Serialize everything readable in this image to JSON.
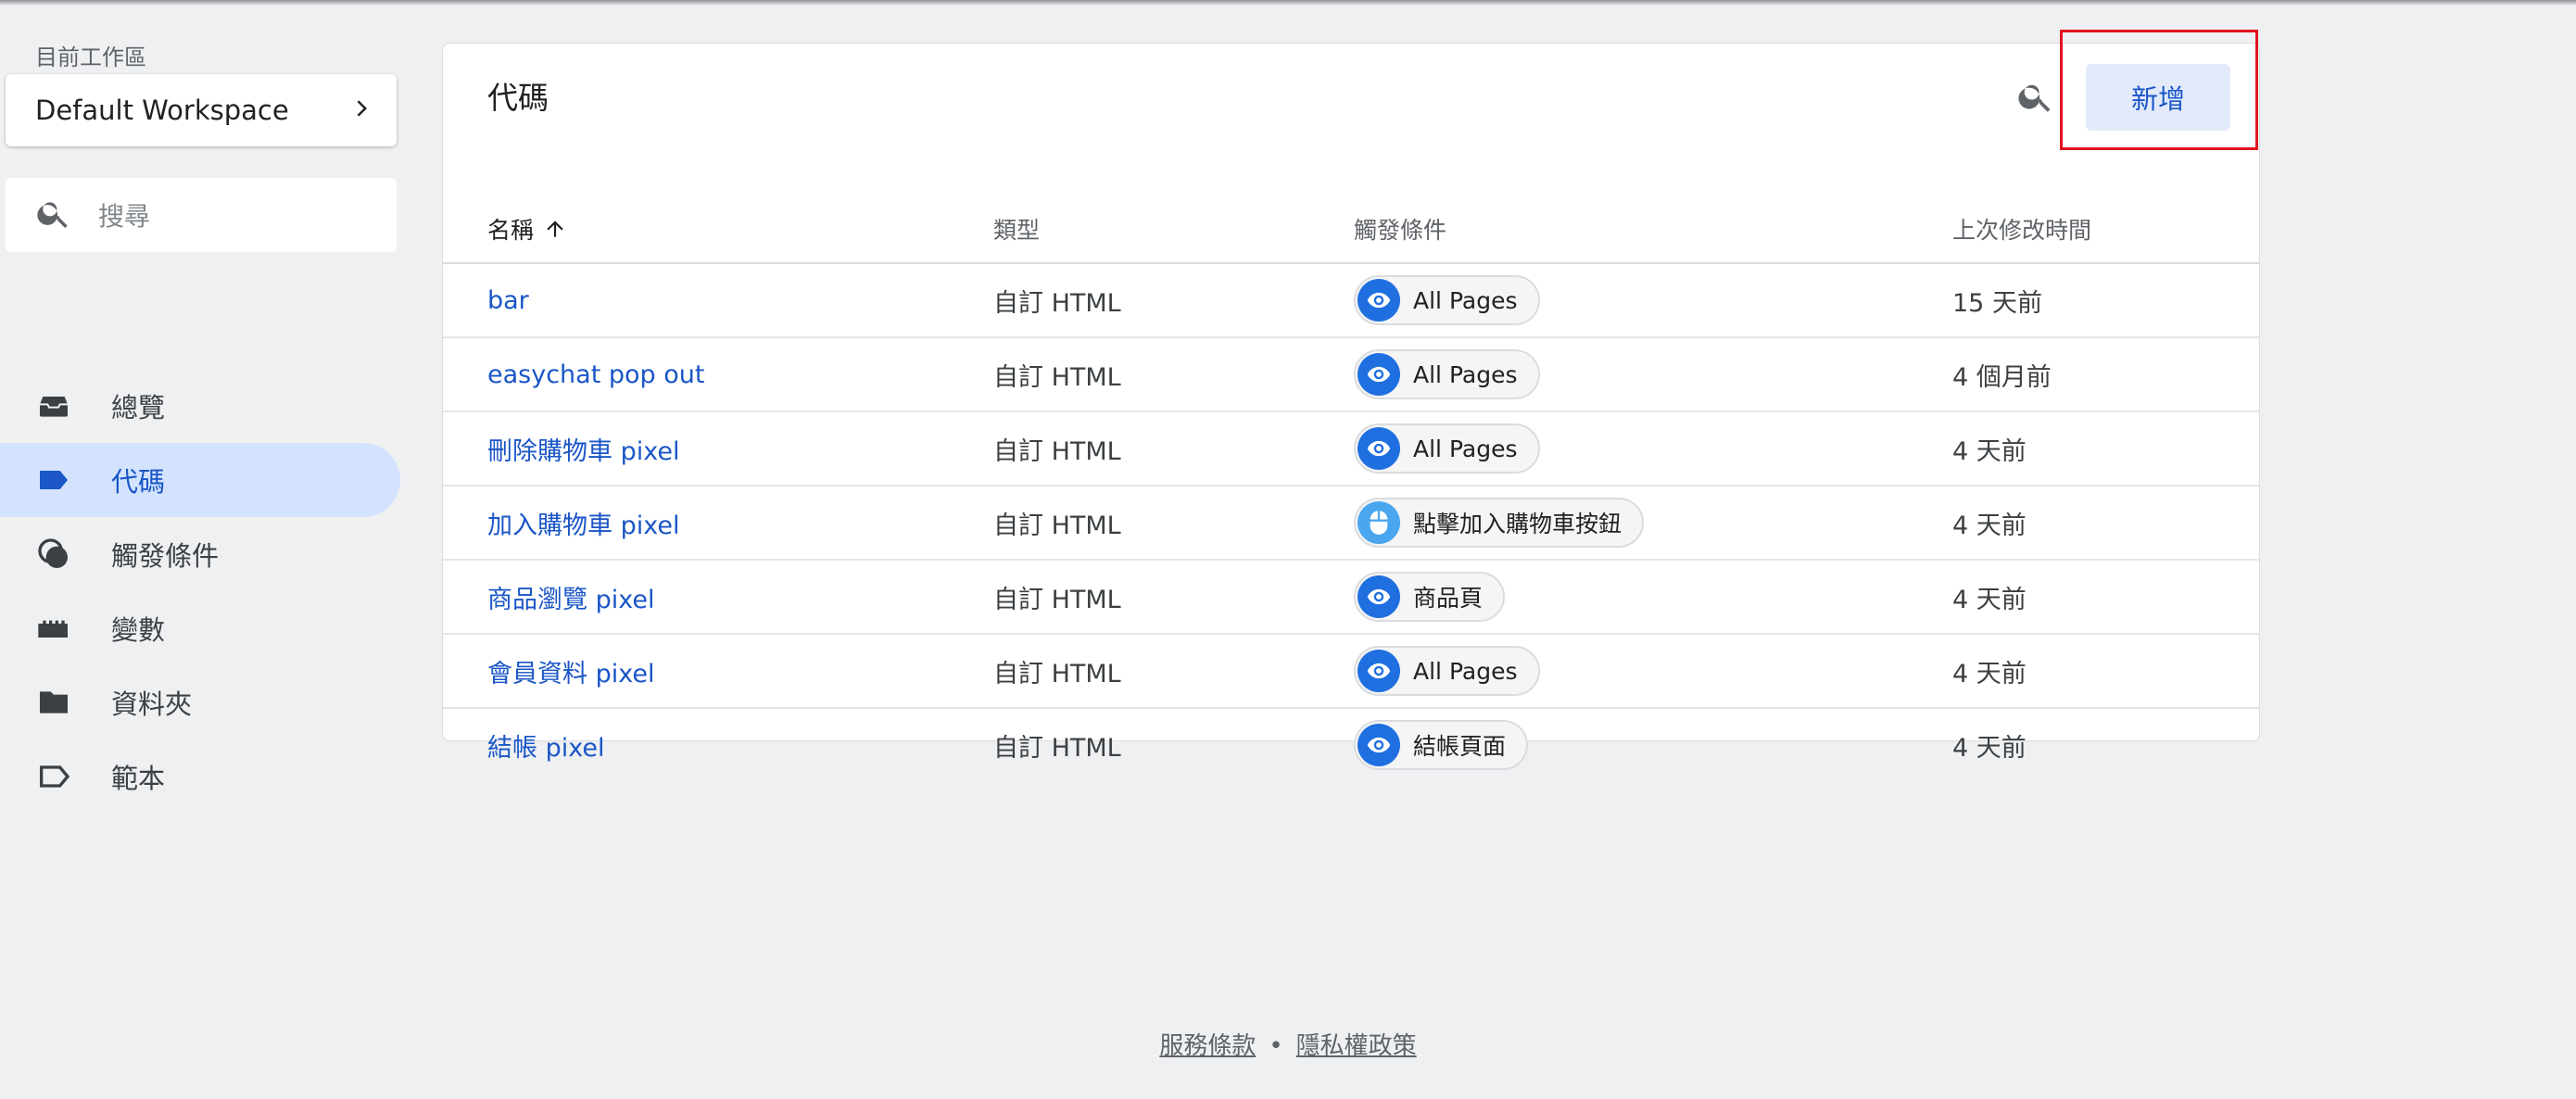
{
  "workspace": {
    "label": "目前工作區",
    "name": "Default Workspace"
  },
  "search": {
    "placeholder": "搜尋"
  },
  "nav": [
    {
      "label": "總覽",
      "icon": "overview-icon"
    },
    {
      "label": "代碼",
      "icon": "tag-icon",
      "active": true
    },
    {
      "label": "觸發條件",
      "icon": "trigger-icon"
    },
    {
      "label": "變數",
      "icon": "variable-icon"
    },
    {
      "label": "資料夾",
      "icon": "folder-icon"
    },
    {
      "label": "範本",
      "icon": "template-icon"
    }
  ],
  "main": {
    "title": "代碼",
    "add_label": "新增",
    "columns": {
      "name": "名稱",
      "type": "類型",
      "trigger": "觸發條件",
      "modified": "上次修改時間"
    },
    "rows": [
      {
        "name": "bar",
        "type": "自訂 HTML",
        "trigger": "All Pages",
        "trigger_icon": "eye-icon",
        "modified": "15 天前"
      },
      {
        "name": "easychat pop out",
        "type": "自訂 HTML",
        "trigger": "All Pages",
        "trigger_icon": "eye-icon",
        "modified": "4 個月前"
      },
      {
        "name": "刪除購物車 pixel",
        "type": "自訂 HTML",
        "trigger": "All Pages",
        "trigger_icon": "eye-icon",
        "modified": "4 天前"
      },
      {
        "name": "加入購物車 pixel",
        "type": "自訂 HTML",
        "trigger": "點擊加入購物車按鈕",
        "trigger_icon": "mouse-icon",
        "modified": "4 天前"
      },
      {
        "name": "商品瀏覽 pixel",
        "type": "自訂 HTML",
        "trigger": "商品頁",
        "trigger_icon": "eye-icon",
        "modified": "4 天前"
      },
      {
        "name": "會員資料 pixel",
        "type": "自訂 HTML",
        "trigger": "All Pages",
        "trigger_icon": "eye-icon",
        "modified": "4 天前"
      },
      {
        "name": "結帳 pixel",
        "type": "自訂 HTML",
        "trigger": "結帳頁面",
        "trigger_icon": "eye-icon",
        "modified": "4 天前"
      }
    ]
  },
  "footer": {
    "terms": "服務條款",
    "separator": "•",
    "privacy": "隱私權政策"
  },
  "colors": {
    "accent": "#1a56c7",
    "active_nav_bg": "#d3e3fd",
    "chip_icon": "#1f6fe0",
    "highlight": "#e0141d"
  }
}
